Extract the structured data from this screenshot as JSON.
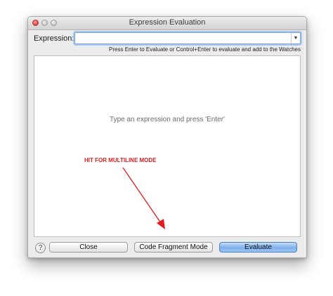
{
  "window": {
    "title": "Expression Evaluation"
  },
  "expression": {
    "label": "Expression:",
    "value": "",
    "hint": "Press Enter to Evaluate or Control+Enter to evaluate and add to the Watches"
  },
  "result_area": {
    "placeholder": "Type an expression and press 'Enter'"
  },
  "annotation": {
    "text": "HIT FOR MULTILINE MODE",
    "color": "#e41b1b"
  },
  "buttons": {
    "help": "?",
    "close": "Close",
    "code_fragment": "Code Fragment Mode",
    "evaluate": "Evaluate"
  },
  "colors": {
    "evaluate_button": "#7fb0ec",
    "close_light": "#e0443e"
  }
}
